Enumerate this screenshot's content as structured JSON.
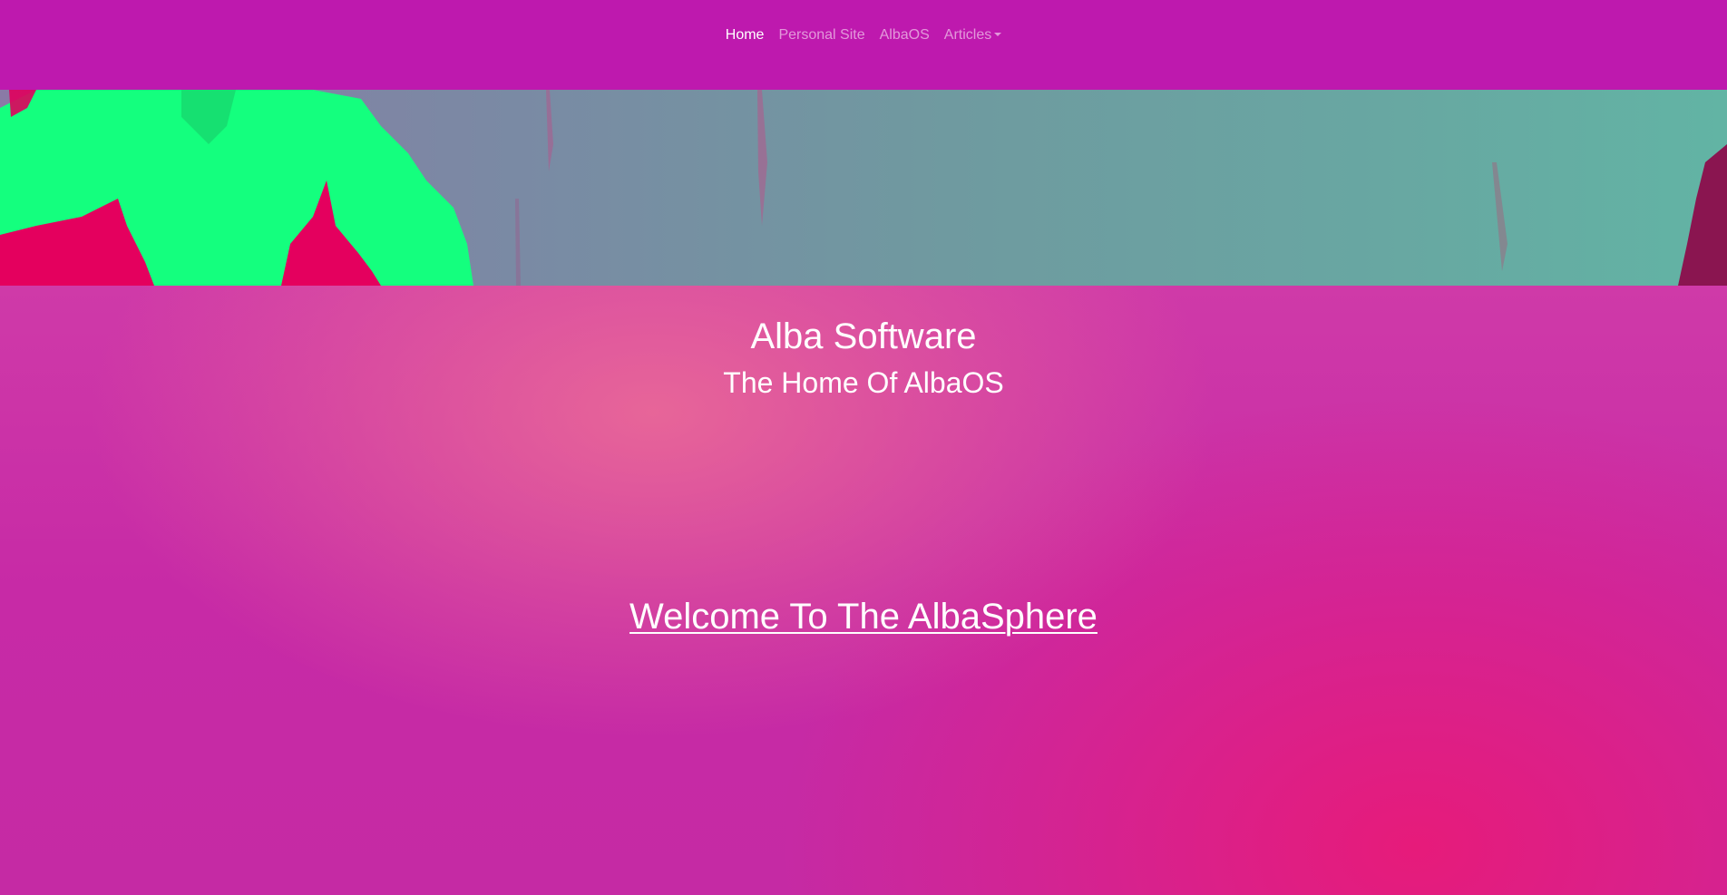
{
  "navbar": {
    "items": [
      {
        "label": "Home",
        "active": true
      },
      {
        "label": "Personal Site",
        "active": false
      },
      {
        "label": "AlbaOS",
        "active": false
      },
      {
        "label": "Articles",
        "active": false,
        "dropdown": true
      }
    ]
  },
  "hero": {
    "title": "Alba Software",
    "subtitle": "The Home Of AlbaOS",
    "welcome": "Welcome To The AlbaSphere"
  },
  "colors": {
    "navbar_bg": "#be19ae",
    "hero_pink": "#e81a78",
    "banner_green": "#12ff7e",
    "banner_red": "#e5005f",
    "text": "#ffffff"
  }
}
